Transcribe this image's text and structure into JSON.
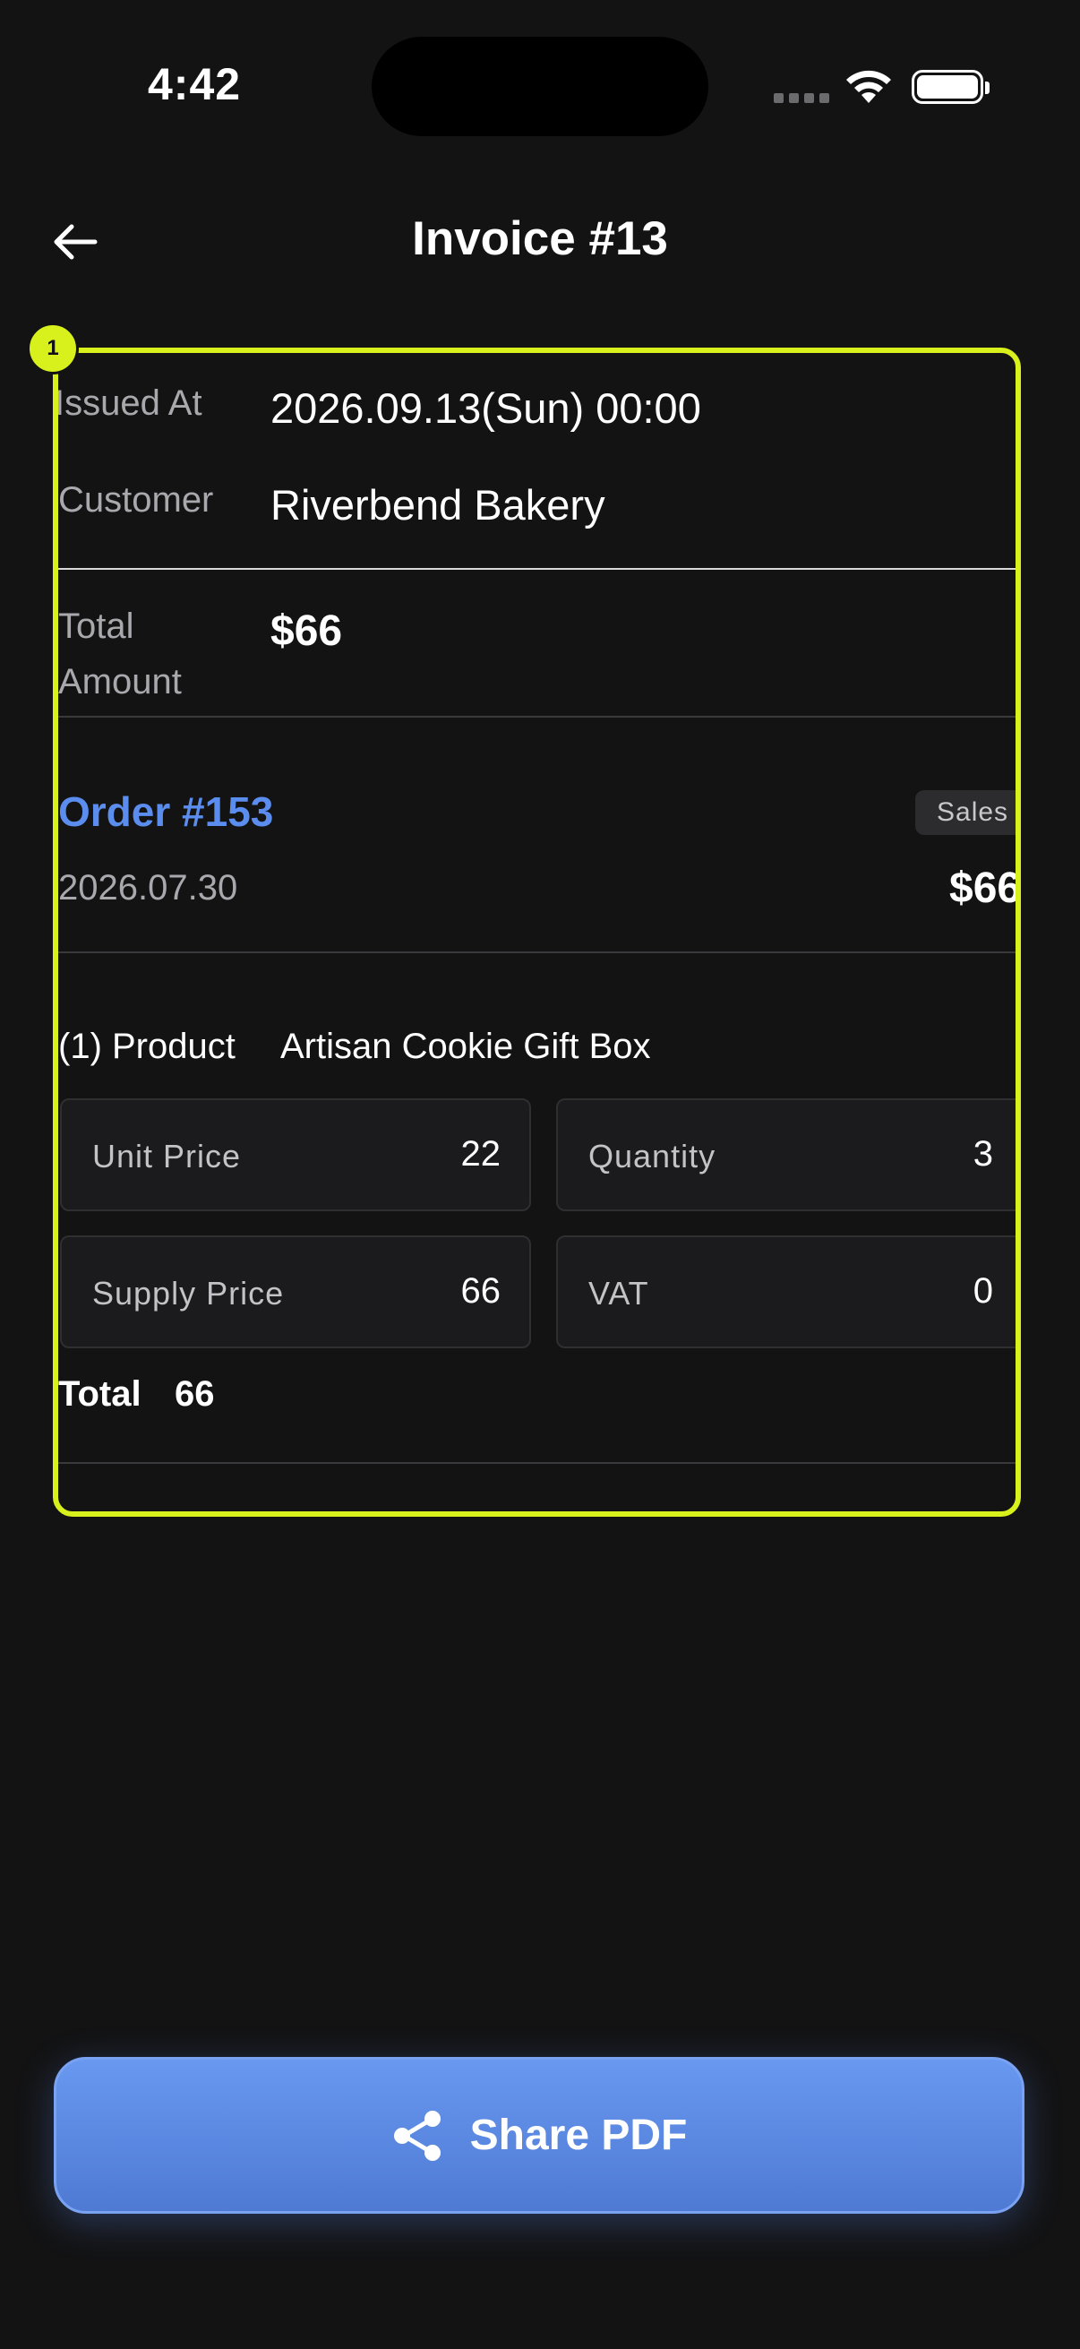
{
  "status_bar": {
    "time": "4:42"
  },
  "header": {
    "title": "Invoice #13"
  },
  "invoice": {
    "issued_at_label": "Issued At",
    "issued_at_value": "2026.09.13(Sun) 00:00",
    "customer_label": "Customer",
    "customer_value": "Riverbend Bakery",
    "total_amount_label_line1": "Total",
    "total_amount_label_line2": "Amount",
    "total_amount_value": "$66"
  },
  "order": {
    "title": "Order #153",
    "badge": "Sales",
    "date": "2026.07.30",
    "amount": "$66"
  },
  "product": {
    "label": "(1) Product",
    "name": "Artisan Cookie Gift Box",
    "cells": [
      {
        "label": "Unit Price",
        "value": "22"
      },
      {
        "label": "Quantity",
        "value": "3"
      },
      {
        "label": "Supply Price",
        "value": "66"
      },
      {
        "label": "VAT",
        "value": "0"
      }
    ],
    "total_label": "Total",
    "total_value": "66"
  },
  "highlight": {
    "marker": "1",
    "color": "#d8f01c"
  },
  "share_button": {
    "label": "Share PDF",
    "icon": "share-icon"
  },
  "colors": {
    "accent": "#5b8def",
    "background": "#131314"
  }
}
